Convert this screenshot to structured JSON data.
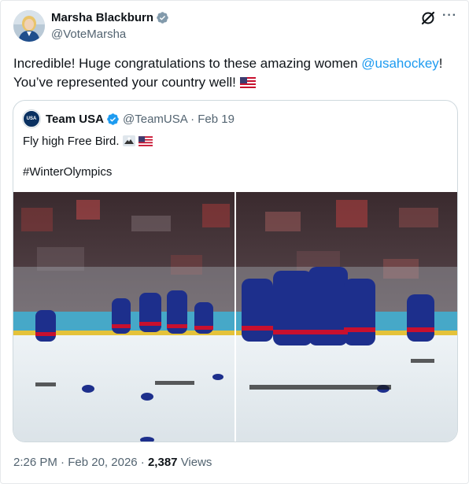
{
  "author": {
    "name": "Marsha Blackburn",
    "handle": "@VoteMarsha",
    "verified_color": "#829aab"
  },
  "icons": {
    "verified": "verified-badge-icon",
    "grok": "grok-icon",
    "more": "more-options-icon"
  },
  "post": {
    "text_before": "Incredible! Huge congratulations to these amazing women ",
    "mention": "@usahockey",
    "text_after": "! You’ve represented your country well! ",
    "flag_emoji": "us-flag-icon"
  },
  "quoted": {
    "name": "Team USA",
    "handle": "@TeamUSA",
    "separator": "·",
    "date": "Feb 19",
    "line1": "Fly high Free Bird. ",
    "hashtag": "#WinterOlympics",
    "avatar_text": "USA",
    "verified_color": "#1d9bf0"
  },
  "meta": {
    "time": "2:26 PM",
    "separator": "·",
    "date": "Feb 20, 2026",
    "separator2": "·",
    "views_count": "2,387",
    "views_label": "Views"
  },
  "colors": {
    "mention": "#1d9bf0",
    "secondary_text": "#536471"
  }
}
